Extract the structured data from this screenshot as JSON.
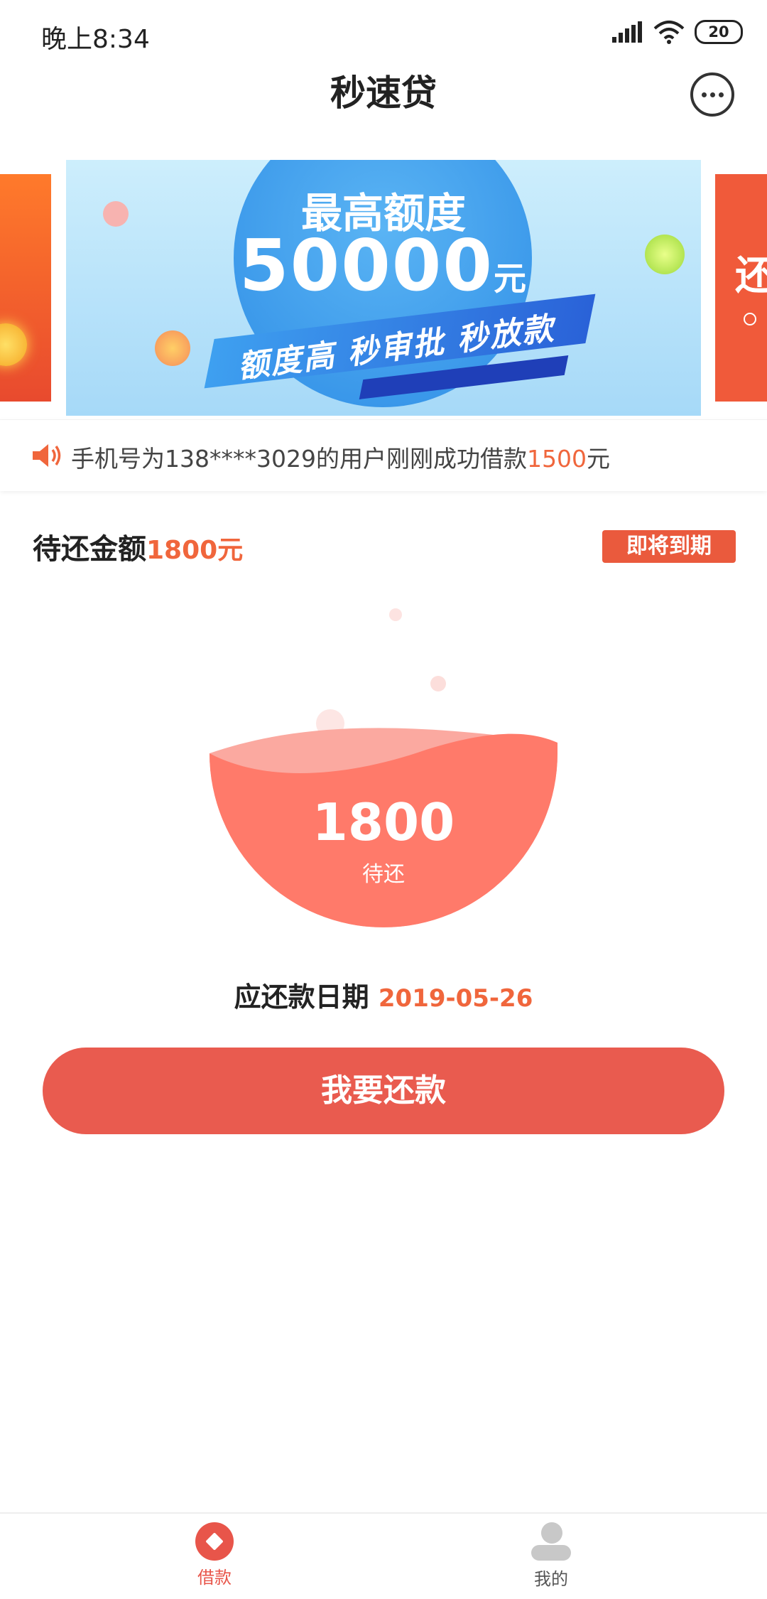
{
  "status": {
    "time": "晚上8:34",
    "battery": "20"
  },
  "header": {
    "title": "秒速贷",
    "chat_icon": "chat-bubble-icon"
  },
  "banner": {
    "line1": "最高额度",
    "amount": "50000",
    "unit": "元",
    "slogan": "额度高 秒审批 秒放款",
    "next_card_text": "还"
  },
  "notice": {
    "prefix": "手机号为138****3029的用户刚刚成功借款",
    "amount": "1500",
    "suffix": "元"
  },
  "due": {
    "label": "待还金额",
    "amount": "1800元",
    "badge": "即将到期"
  },
  "bowl": {
    "value": "1800",
    "caption": "待还"
  },
  "pay_date": {
    "label": "应还款日期",
    "date": "2019-05-26"
  },
  "pay_button": "我要还款",
  "tabs": [
    {
      "label": "借款",
      "icon": "loan-icon",
      "active": true
    },
    {
      "label": "我的",
      "icon": "user-icon",
      "active": false
    }
  ],
  "colors": {
    "accent": "#e95b4f",
    "highlight": "#f0663c",
    "bowl": "#ff7a6a"
  }
}
